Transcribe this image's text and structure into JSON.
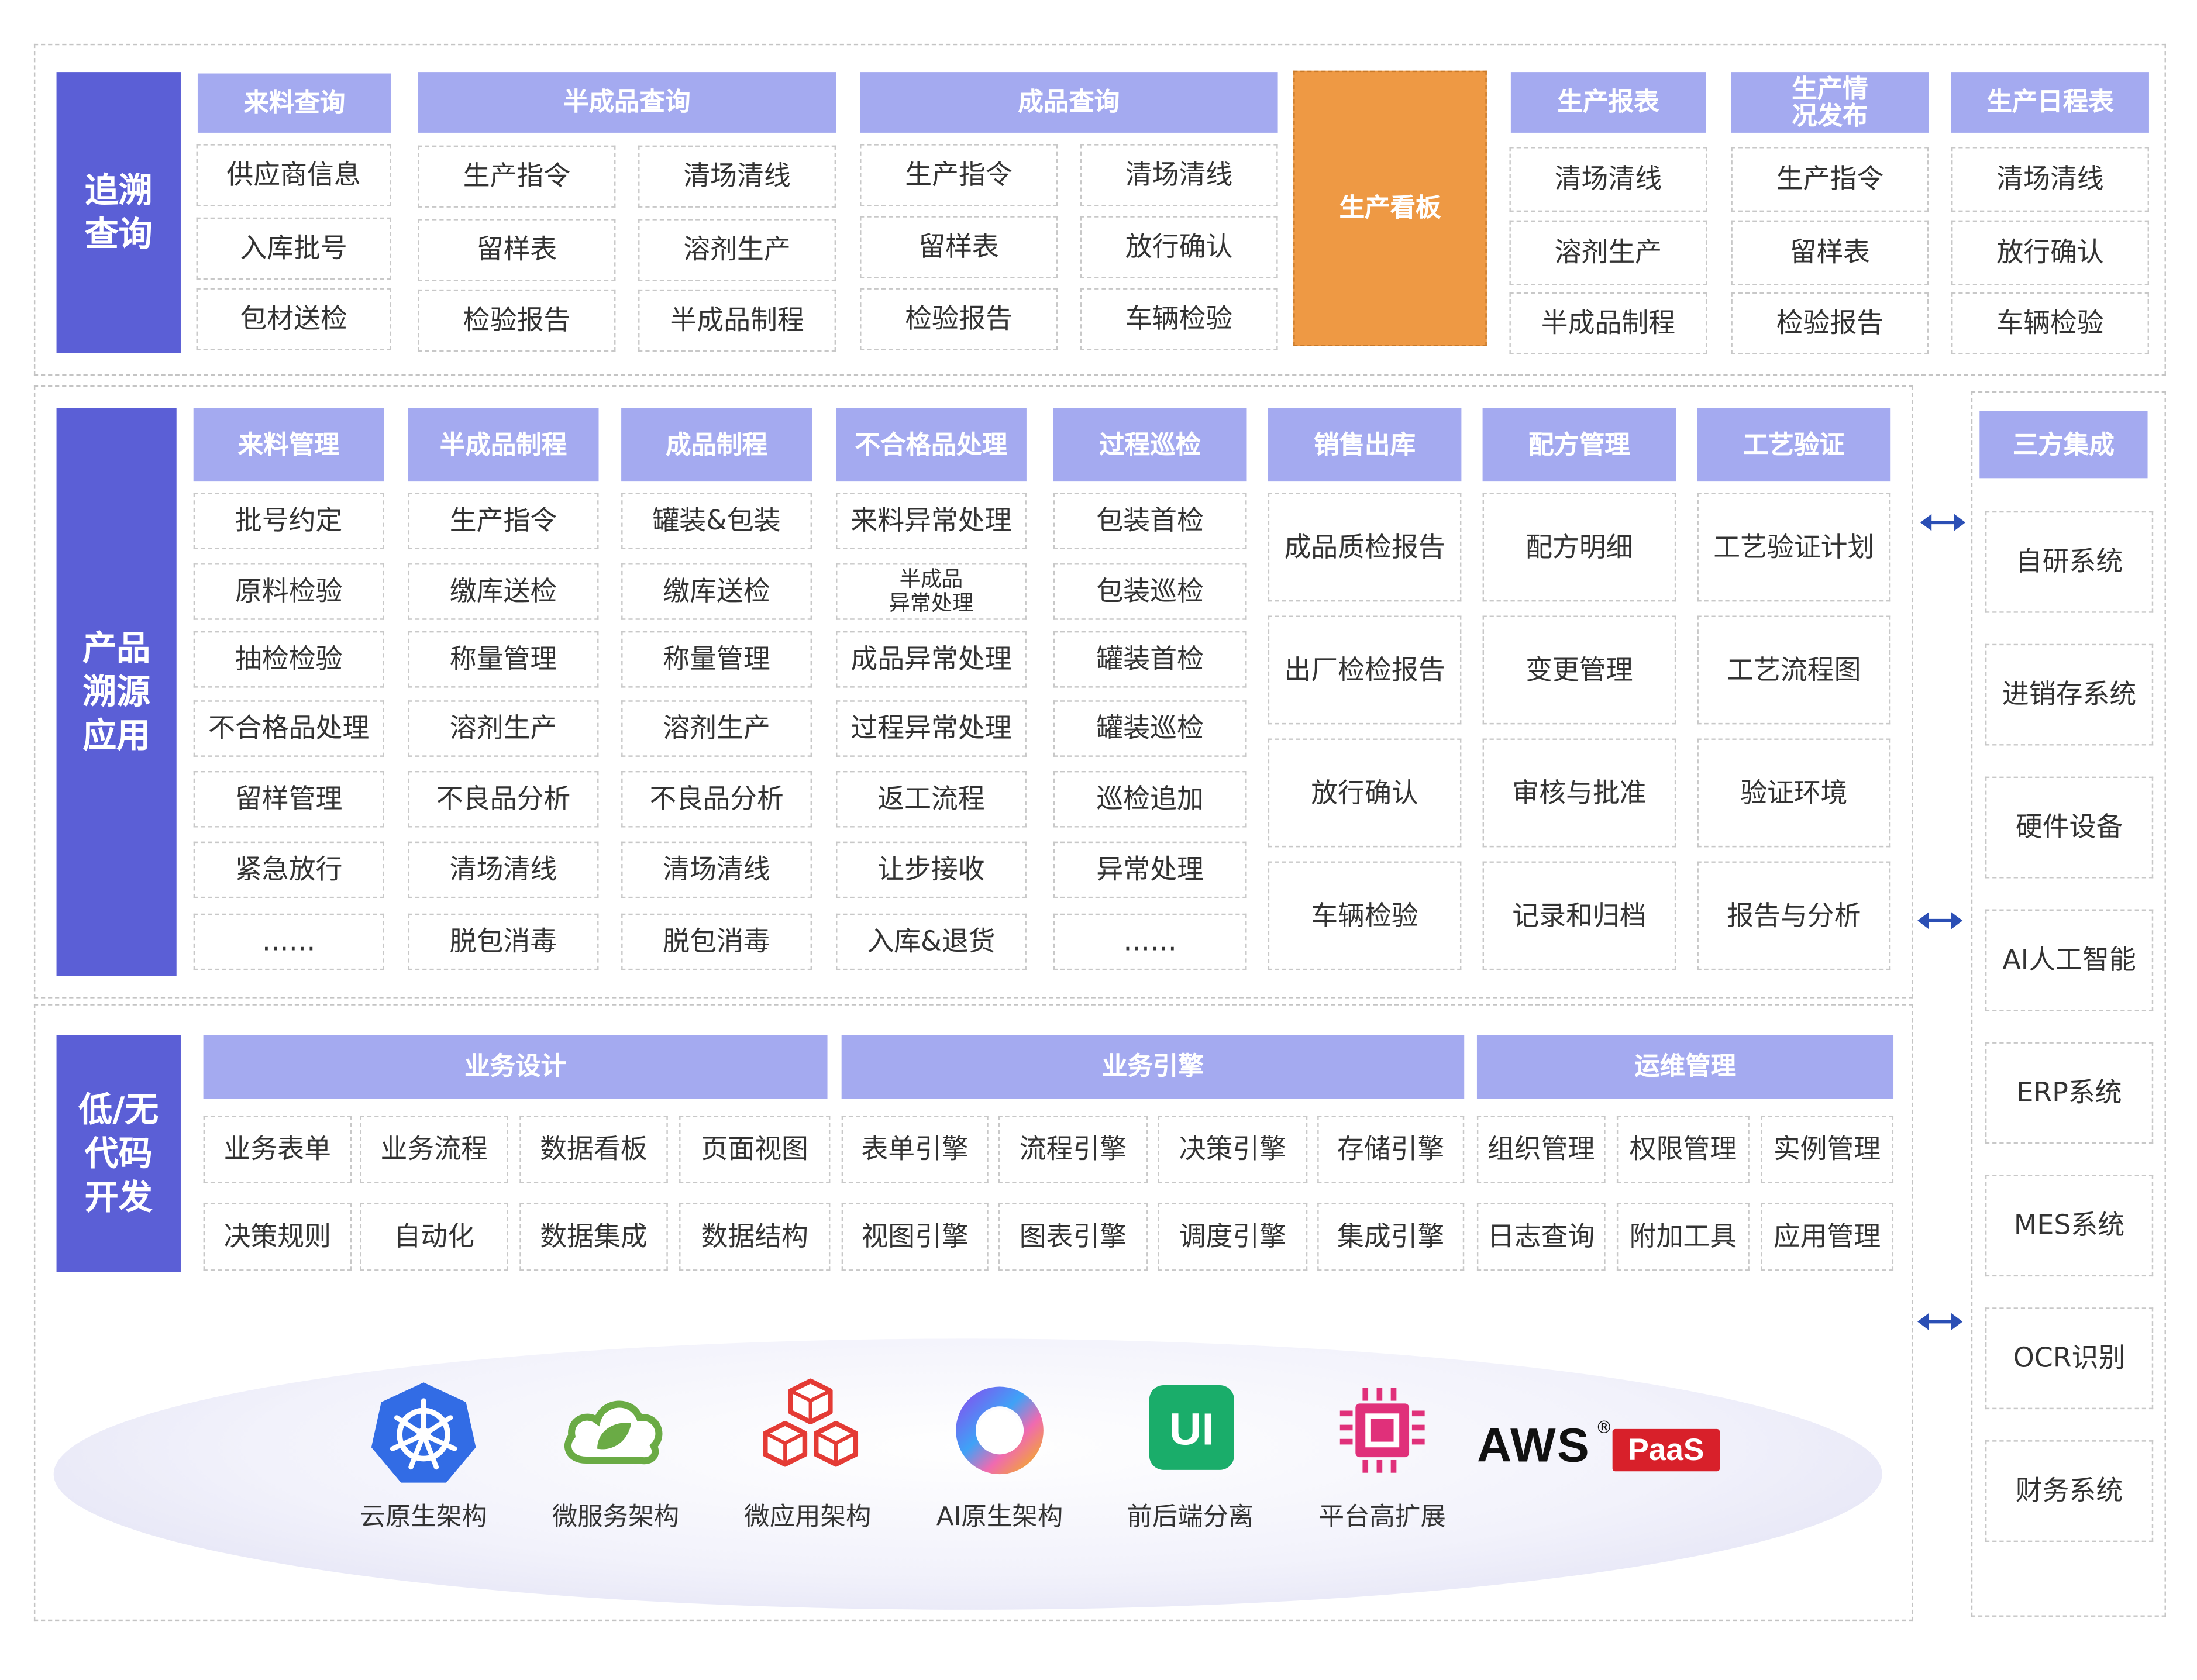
{
  "trace": {
    "label": "追溯\n查询",
    "groups": [
      {
        "title": "来料查询",
        "items": [
          "供应商信息",
          "入库批号",
          "包材送检"
        ]
      },
      {
        "title": "半成品查询",
        "items": [
          "生产指令",
          "清场清线",
          "留样表",
          "溶剂生产",
          "检验报告",
          "半成品制程"
        ]
      },
      {
        "title": "成品查询",
        "items": [
          "生产指令",
          "清场清线",
          "留样表",
          "放行确认",
          "检验报告",
          "车辆检验"
        ]
      },
      {
        "title": "生产看板"
      },
      {
        "title": "生产报表",
        "items": [
          "清场清线",
          "溶剂生产",
          "半成品制程"
        ]
      },
      {
        "title": "生产情\n况发布",
        "items": [
          "生产指令",
          "留样表",
          "检验报告"
        ]
      },
      {
        "title": "生产日程表",
        "items": [
          "清场清线",
          "放行确认",
          "车辆检验"
        ]
      }
    ]
  },
  "product": {
    "label": "产品\n溯源\n应用",
    "columns": [
      {
        "title": "来料管理",
        "items": [
          "批号约定",
          "原料检验",
          "抽检检验",
          "不合格品处理",
          "留样管理",
          "紧急放行",
          "……"
        ]
      },
      {
        "title": "半成品制程",
        "items": [
          "生产指令",
          "缴库送检",
          "称量管理",
          "溶剂生产",
          "不良品分析",
          "清场清线",
          "脱包消毒"
        ]
      },
      {
        "title": "成品制程",
        "items": [
          "罐装&包装",
          "缴库送检",
          "称量管理",
          "溶剂生产",
          "不良品分析",
          "清场清线",
          "脱包消毒"
        ]
      },
      {
        "title": "不合格品处理",
        "items": [
          "来料异常处理",
          "半成品\n异常处理",
          "成品异常处理",
          "过程异常处理",
          "返工流程",
          "让步接收",
          "入库&退货"
        ]
      },
      {
        "title": "过程巡检",
        "items": [
          "包装首检",
          "包装巡检",
          "罐装首检",
          "罐装巡检",
          "巡检追加",
          "异常处理",
          "……"
        ]
      },
      {
        "title": "销售出库",
        "items": [
          "成品质检报告",
          "出厂检检报告",
          "放行确认",
          "车辆检验"
        ]
      },
      {
        "title": "配方管理",
        "items": [
          "配方明细",
          "变更管理",
          "审核与批准",
          "记录和归档"
        ]
      },
      {
        "title": "工艺验证",
        "items": [
          "工艺验证计划",
          "工艺流程图",
          "验证环境",
          "报告与分析"
        ]
      }
    ]
  },
  "lowcode": {
    "label": "低/无\n代码\n开发",
    "groups": [
      {
        "title": "业务设计",
        "items": [
          "业务表单",
          "业务流程",
          "数据看板",
          "页面视图",
          "决策规则",
          "自动化",
          "数据集成",
          "数据结构"
        ]
      },
      {
        "title": "业务引擎",
        "items": [
          "表单引擎",
          "流程引擎",
          "决策引擎",
          "存储引擎",
          "视图引擎",
          "图表引擎",
          "调度引擎",
          "集成引擎"
        ]
      },
      {
        "title": "运维管理",
        "items": [
          "组织管理",
          "权限管理",
          "实例管理",
          "日志查询",
          "附加工具",
          "应用管理"
        ]
      }
    ]
  },
  "tech": [
    {
      "label": "云原生架构",
      "icon": "kubernetes-icon"
    },
    {
      "label": "微服务架构",
      "icon": "cloud-leaf-icon"
    },
    {
      "label": "微应用架构",
      "icon": "cubes-icon"
    },
    {
      "label": "AI原生架构",
      "icon": "ai-ring-icon"
    },
    {
      "label": "前后端分离",
      "icon": "ui-icon"
    },
    {
      "label": "平台高扩展",
      "icon": "chip-icon"
    }
  ],
  "aws": {
    "logo": "AWS",
    "reg": "®",
    "paas": "PaaS"
  },
  "integration": {
    "title": "三方集成",
    "items": [
      "自研系统",
      "进销存系统",
      "硬件设备",
      "AI人工智能",
      "ERP系统",
      "MES系统",
      "OCR识别",
      "财务系统"
    ]
  },
  "colors": {
    "label": "#5b5fd6",
    "header": "#a4aaf0",
    "orange": "#ee9944",
    "arrow": "#2b4fb5"
  }
}
